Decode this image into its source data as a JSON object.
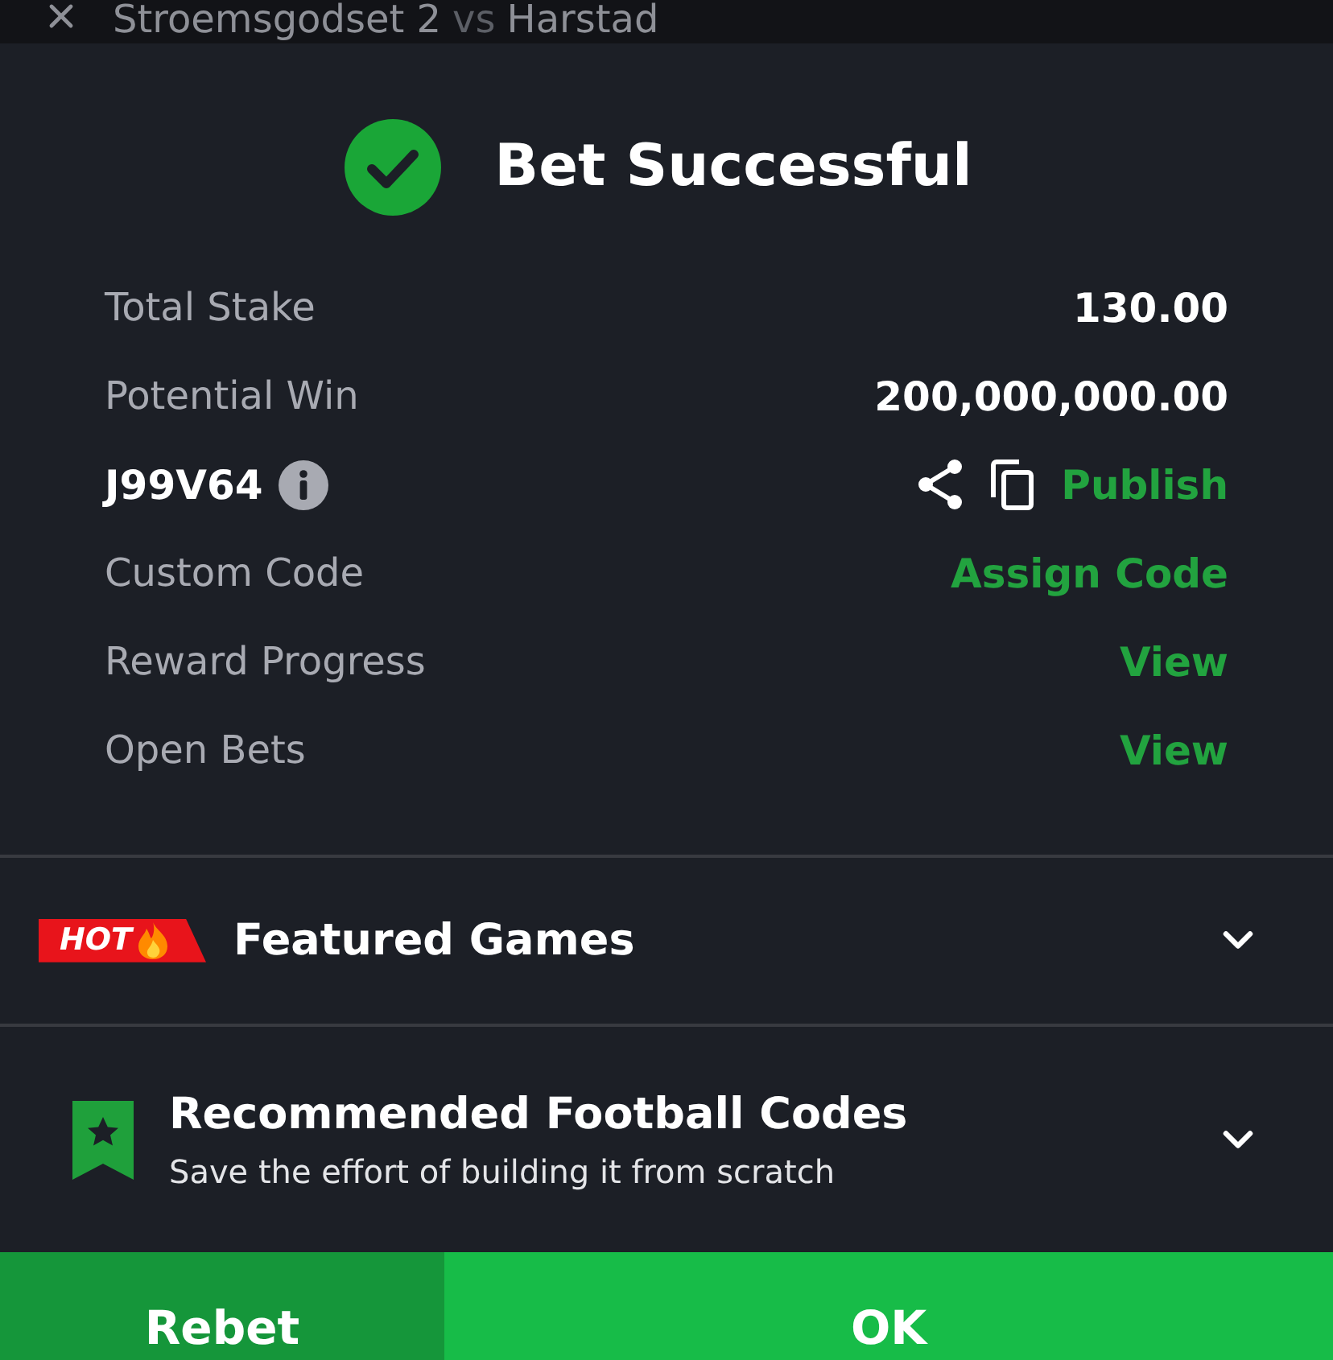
{
  "match_bar": {
    "home": "Stroemsgodset 2",
    "separator": "vs",
    "away": "Harstad"
  },
  "result": {
    "title": "Bet Successful"
  },
  "details": [
    {
      "kind": "amount",
      "label": "Total Stake",
      "value": "130.00"
    },
    {
      "kind": "amount",
      "label": "Potential Win",
      "value": "200,000,000.00"
    },
    {
      "kind": "code",
      "code": "J99V64",
      "action": "Publish"
    },
    {
      "kind": "link",
      "label": "Custom Code",
      "action": "Assign Code"
    },
    {
      "kind": "link",
      "label": "Reward Progress",
      "action": "View"
    },
    {
      "kind": "link",
      "label": "Open Bets",
      "action": "View"
    }
  ],
  "sections": [
    {
      "kind": "hot",
      "badge": "HOT",
      "title": "Featured Games",
      "expanded": false
    },
    {
      "kind": "bookmark",
      "title": "Recommended Football Codes",
      "subtitle": "Save the effort of building it from scratch",
      "expanded": false
    }
  ],
  "buttons": [
    {
      "kind": "secondary",
      "label": "Rebet"
    },
    {
      "kind": "primary",
      "label": "OK"
    }
  ]
}
